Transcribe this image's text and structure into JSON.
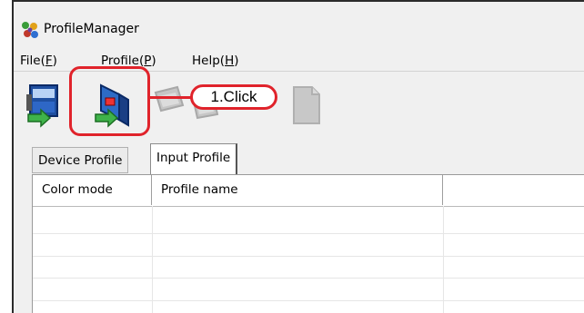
{
  "window": {
    "title": "ProfileManager",
    "app_icon": "profilemanager-app-icon"
  },
  "menu": [
    {
      "label": "File",
      "mnemonic": "F"
    },
    {
      "label": "Profile",
      "mnemonic": "P"
    },
    {
      "label": "Help",
      "mnemonic": "H"
    }
  ],
  "toolbar": {
    "buttons": [
      {
        "name": "device-profile-import-button",
        "icon": "printer-import-icon",
        "enabled": true
      },
      {
        "name": "input-profile-import-button",
        "icon": "scanner-import-icon",
        "enabled": true
      },
      {
        "name": "disabled-tool-3-button",
        "icon": "transfer-icon",
        "enabled": false
      },
      {
        "name": "disabled-tool-4-button",
        "icon": "transfer-icon",
        "enabled": false
      },
      {
        "name": "disabled-tool-5-button",
        "icon": "document-icon",
        "enabled": false
      }
    ]
  },
  "callout": {
    "label": "1.Click",
    "color": "#e0232b"
  },
  "tabs": [
    {
      "label": "Device Profile",
      "active": false
    },
    {
      "label": "Input Profile",
      "active": true
    }
  ],
  "list": {
    "columns": [
      "Color mode",
      "Profile name",
      ""
    ],
    "rows": []
  }
}
